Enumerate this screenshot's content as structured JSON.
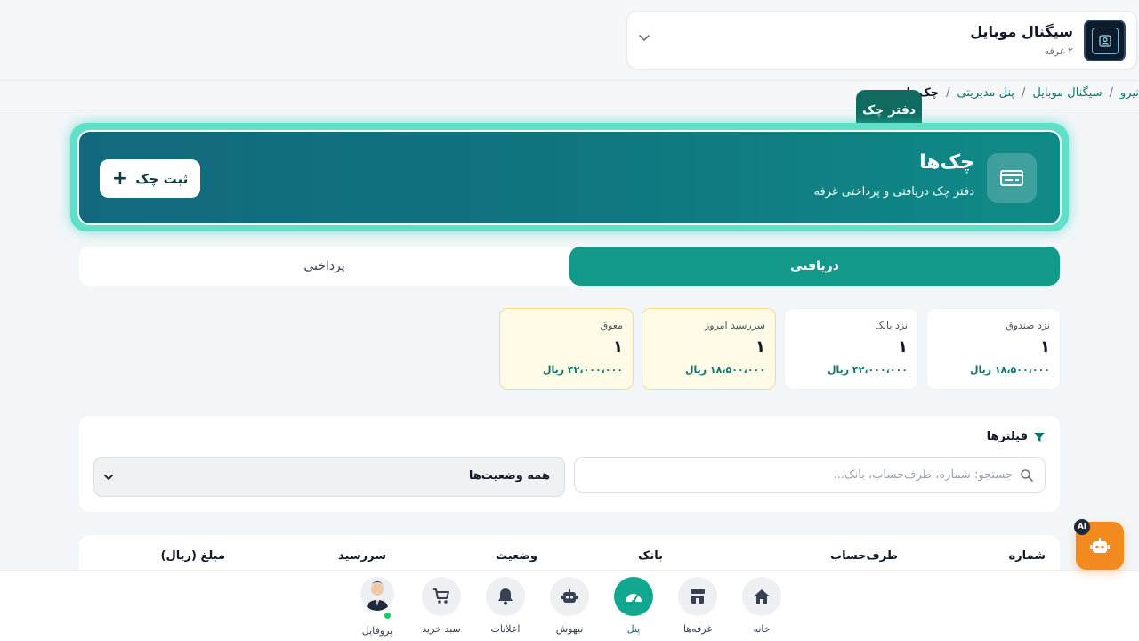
{
  "store": {
    "name": "سیگنال موبایل",
    "sub": "۲ غرفه"
  },
  "breadcrumb": {
    "items": [
      "نیرو",
      "سیگنال موبایل",
      "پنل مدیریتی"
    ],
    "hidden_sep": "/",
    "current": "چک‌ها"
  },
  "tooltip": "دفتر چک",
  "hero": {
    "title": "چک‌ها",
    "subtitle": "دفتر چک دریافتی و پرداختی غرفه",
    "add_button": "ثبت چک"
  },
  "tabs": {
    "received": "دریافتی",
    "paid": "پرداختی"
  },
  "stats": [
    {
      "label": "نزد صندوق",
      "count": "۱",
      "amount": "۱۸،۵۰۰،۰۰۰ ریال"
    },
    {
      "label": "نزد بانک",
      "count": "۱",
      "amount": "۴۲،۰۰۰،۰۰۰ ریال"
    },
    {
      "label": "سررسید امروز",
      "count": "۱",
      "amount": "۱۸،۵۰۰،۰۰۰ ریال"
    },
    {
      "label": "معوق",
      "count": "۱",
      "amount": "۴۲،۰۰۰،۰۰۰ ریال"
    }
  ],
  "filters": {
    "title": "فیلترها",
    "search_placeholder": "جستجو: شماره، طرف‌حساب، بانک...",
    "status_value": "همه وضعیت‌ها"
  },
  "table": {
    "headers": [
      "شماره",
      "طرف‌حساب",
      "بانک",
      "وضعیت",
      "سررسید",
      "مبلغ (ریال)"
    ]
  },
  "nav": {
    "home": "خانه",
    "booths": "غرفه‌ها",
    "panel": "پنل",
    "ai": "نیهوش",
    "notifications": "اعلانات",
    "cart": "سبد خرید",
    "profile": "پروفایل"
  },
  "ai_badge": "AI",
  "colors": {
    "accent": "#12998a",
    "hero_start": "#0f8b87",
    "hero_end": "#12697e",
    "warn_bg": "#fffbe6",
    "ai_orange": "#f28a1e"
  }
}
